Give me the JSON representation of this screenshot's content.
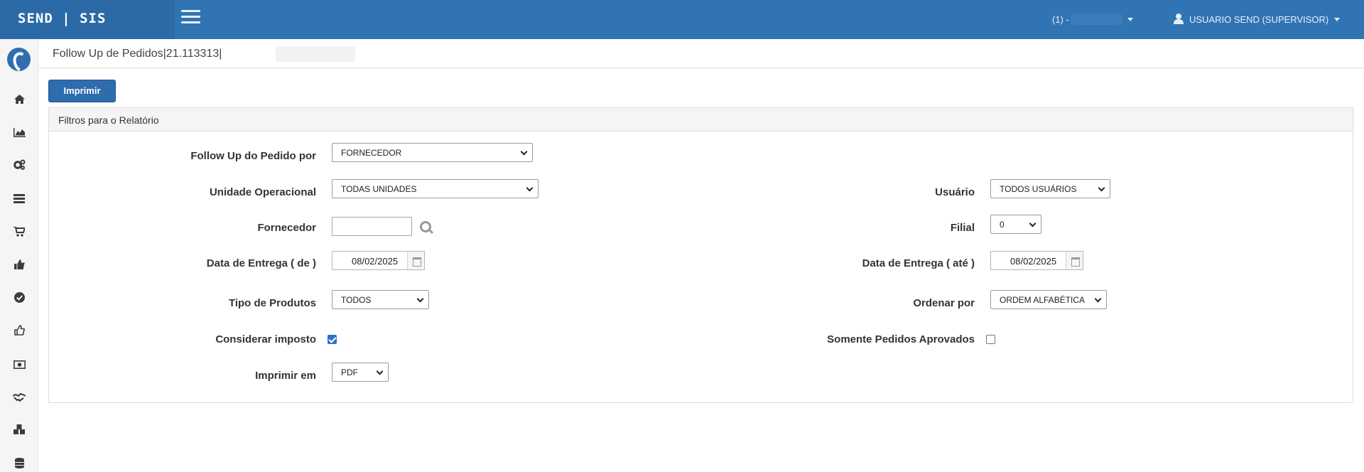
{
  "header": {
    "brand": "SEND | SIS",
    "tenant": "(1) -",
    "user": "USUARIO SEND (SUPERVISOR)"
  },
  "sidebar": {
    "icons": [
      "logo",
      "home-icon",
      "chart-area-icon",
      "cogs-icon",
      "list-icon",
      "cart-icon",
      "thumbs-up-icon",
      "check-circle-icon",
      "thumbs-up-outline-icon",
      "money-icon",
      "handshake-icon",
      "cubes-icon",
      "database-icon"
    ]
  },
  "page": {
    "title": "Follow Up de Pedidos|21.113313|",
    "print_button": "Imprimir",
    "panel_title": "Filtros para o Relatório"
  },
  "form": {
    "followup_label": "Follow Up do Pedido por",
    "followup_value": "FORNECEDOR",
    "unidade_label": "Unidade Operacional",
    "unidade_value": "TODAS UNIDADES",
    "usuario_label": "Usuário",
    "usuario_value": "TODOS USUÁRIOS",
    "fornecedor_label": "Fornecedor",
    "fornecedor_value": "",
    "filial_label": "Filial",
    "filial_value": "0",
    "data_de_label": "Data de Entrega ( de )",
    "data_de_value": "08/02/2025",
    "data_ate_label": "Data de Entrega ( até )",
    "data_ate_value": "08/02/2025",
    "tipo_label": "Tipo de Produtos",
    "tipo_value": "TODOS",
    "ordenar_label": "Ordenar por",
    "ordenar_value": "ORDEM ALFABÉTICA",
    "imposto_label": "Considerar imposto",
    "imposto_checked": true,
    "aprovados_label": "Somente Pedidos Aprovados",
    "aprovados_checked": false,
    "imprimir_em_label": "Imprimir em",
    "imprimir_em_value": "PDF"
  }
}
